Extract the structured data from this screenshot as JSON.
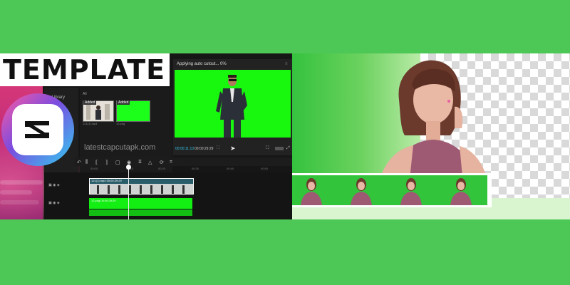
{
  "banner": {
    "title": "TEMPLATE"
  },
  "app": {
    "logo_icon": "capcut-logo-icon",
    "accent": "#e0407a"
  },
  "library": {
    "label": "▸ Library",
    "tab": "All"
  },
  "media": [
    {
      "badge": "Added",
      "name": "121(1).mp4"
    },
    {
      "badge": "Added",
      "name": "12.png"
    }
  ],
  "watermark": "latestcapcutapk.com",
  "player": {
    "status": "Applying auto cutout... 0%",
    "time_current": "00:00:11:13",
    "time_total": "00:00:29:29",
    "bg": "#18f80f"
  },
  "timeline": {
    "ticks": [
      "00:00",
      "00:10",
      "00:20",
      "00:30",
      "00:40",
      "00:50"
    ],
    "video_clip_name": "121(1).mp4  00:00:29:29",
    "green_clip_name": "12.png  00:00:29:29"
  },
  "colors": {
    "page_bg": "#4dc755",
    "chroma_green": "#18f80f"
  }
}
